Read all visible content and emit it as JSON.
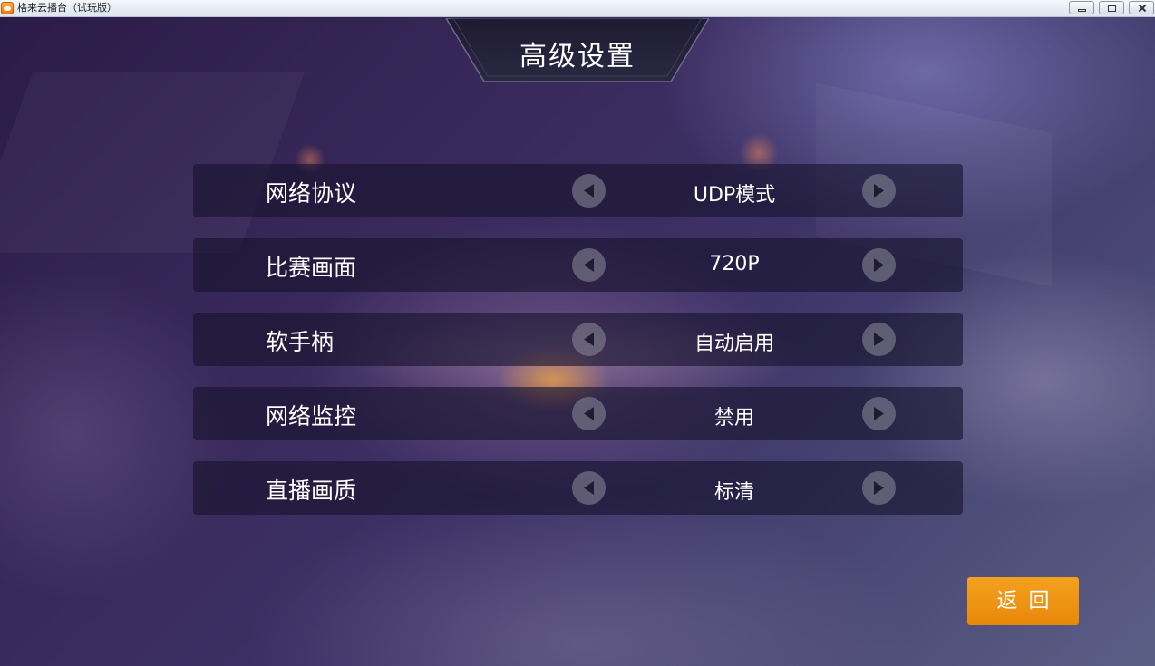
{
  "window": {
    "title": "格来云播台（试玩版）",
    "icon": "app-logo-icon"
  },
  "header": {
    "title": "高级设置"
  },
  "settings": [
    {
      "label": "网络协议",
      "value": "UDP模式"
    },
    {
      "label": "比赛画面",
      "value": "720P"
    },
    {
      "label": "软手柄",
      "value": "自动启用"
    },
    {
      "label": "网络监控",
      "value": "禁用"
    },
    {
      "label": "直播画质",
      "value": "标清"
    }
  ],
  "back_button": {
    "label": "返回"
  },
  "colors": {
    "accent": "#ef9514",
    "row_background": "#16142d",
    "text": "#ffffff"
  }
}
